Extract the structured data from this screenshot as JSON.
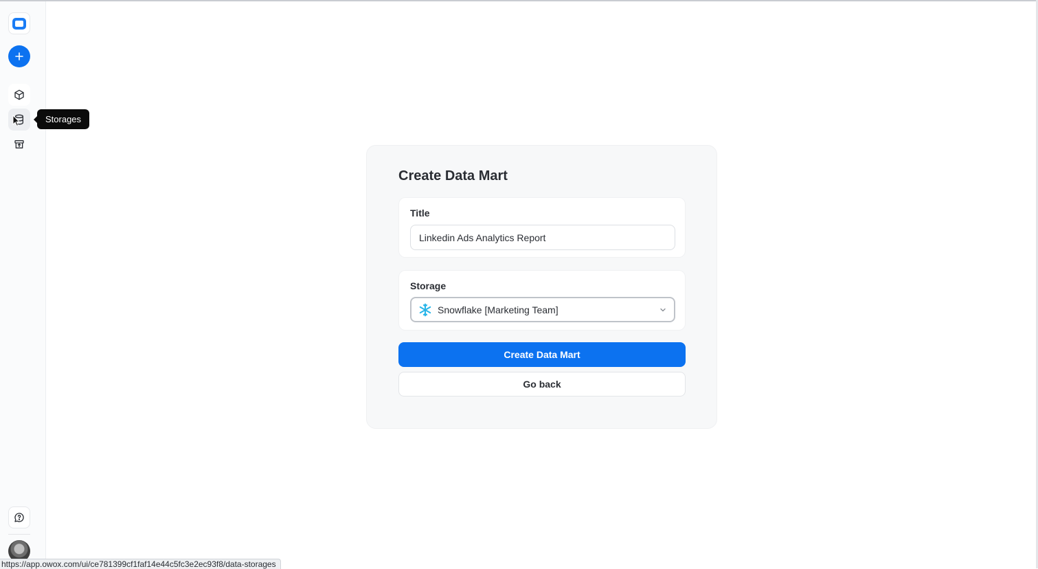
{
  "sidebar": {
    "logo_icon": "app-logo-icon",
    "add_icon": "plus-icon",
    "items": [
      {
        "icon": "cube-icon",
        "label": "Data Marts"
      },
      {
        "icon": "database-icon",
        "label": "Storages"
      },
      {
        "icon": "archive-icon",
        "label": "Archive"
      }
    ],
    "chat_icon": "chat-help-icon"
  },
  "tooltip": {
    "text": "Storages"
  },
  "form": {
    "heading": "Create Data Mart",
    "title_label": "Title",
    "title_value": "Linkedin Ads Analytics Report",
    "storage_label": "Storage",
    "storage_value": "Snowflake [Marketing Team]",
    "storage_icon": "snowflake-icon",
    "create_label": "Create Data Mart",
    "back_label": "Go back"
  },
  "colors": {
    "accent": "#0c72f0",
    "snowflake": "#29b5e8"
  },
  "statusbar": {
    "url": "https://app.owox.com/ui/ce781399cf1faf14e44c5fc3e2ec93f8/data-storages"
  }
}
